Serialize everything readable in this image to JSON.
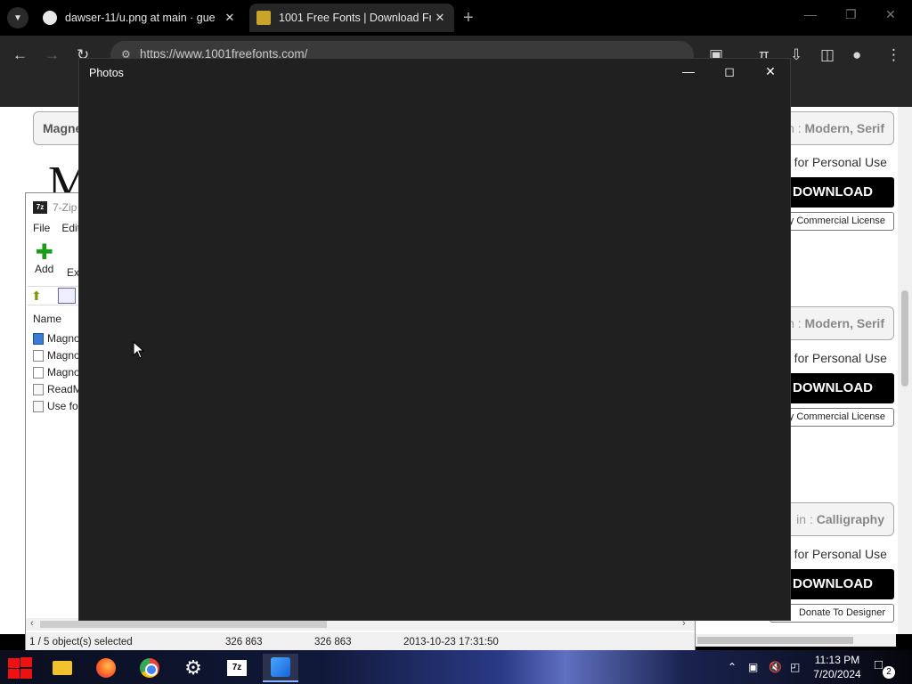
{
  "browser": {
    "tabs": [
      {
        "title": "dawser-11/u.png at main · gue",
        "favicon": "github-icon"
      },
      {
        "title": "1001 Free Fonts | Download Fr",
        "favicon": "1001fonts-icon"
      }
    ],
    "url": "https://www.1001freefonts.com/"
  },
  "page": {
    "cards": [
      {
        "name": "Magne",
        "tags_prefix": "n : ",
        "tags": "Modern, Serif",
        "personal": "e for Personal Use",
        "download": "DOWNLOAD",
        "license": "y Commercial License"
      },
      {
        "name": "",
        "tags_prefix": "n : ",
        "tags": "Modern, Serif",
        "personal": "e for Personal Use",
        "download": "DOWNLOAD",
        "license": "y Commercial License"
      },
      {
        "name": "",
        "tags_prefix": "in : ",
        "tags": "Calligraphy",
        "personal": "e for Personal Use",
        "download": "DOWNLOAD",
        "license": "Donate To Designer"
      }
    ],
    "preview_glyph": "M"
  },
  "zip": {
    "title": "7-Zip",
    "menu": [
      "File",
      "Edit"
    ],
    "add_label": "Add",
    "extract_label": "Ex",
    "column_name": "Name",
    "rows": [
      {
        "name": "Magno",
        "icon": "file-blue"
      },
      {
        "name": "Magno",
        "icon": "font-file"
      },
      {
        "name": "Magno",
        "icon": "font-file"
      },
      {
        "name": "ReadM",
        "icon": "text-file"
      },
      {
        "name": "Use fo",
        "icon": "text-file"
      }
    ],
    "status": {
      "selected": "1 / 5 object(s) selected",
      "size": "326 863",
      "packed": "326 863",
      "modified": "2013-10-23 17:31:50"
    }
  },
  "photos": {
    "title": "Photos"
  },
  "taskbar": {
    "apps": [
      "start-icon",
      "file-explorer-icon",
      "firefox-icon",
      "chrome-icon",
      "settings-icon",
      "7zip-icon",
      "photos-icon"
    ],
    "time": "11:13 PM",
    "date": "7/20/2024",
    "notifications": "2"
  }
}
